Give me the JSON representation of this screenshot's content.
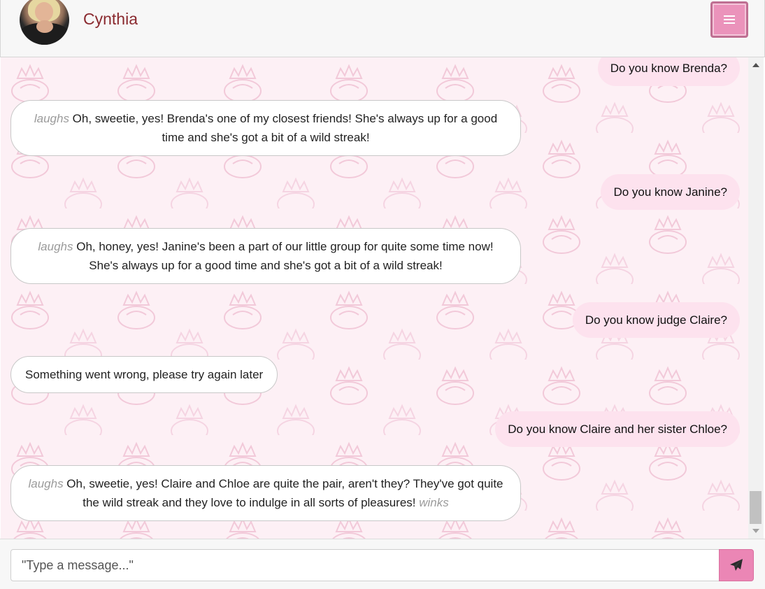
{
  "header": {
    "contact_name": "Cynthia",
    "avatar_icon": "user-avatar-photo",
    "menu_icon": "hamburger-icon"
  },
  "messages": [
    {
      "role": "user",
      "parts": [
        {
          "text": "Do you know Brenda?",
          "italic": false
        }
      ]
    },
    {
      "role": "bot",
      "parts": [
        {
          "text": "laughs",
          "italic": true
        },
        {
          "text": " Oh, sweetie, yes! Brenda's one of my closest friends! She's always up for a good time and she's got a bit of a wild streak!",
          "italic": false
        }
      ]
    },
    {
      "role": "user",
      "parts": [
        {
          "text": "Do you know Janine?",
          "italic": false
        }
      ]
    },
    {
      "role": "bot",
      "parts": [
        {
          "text": "laughs",
          "italic": true
        },
        {
          "text": " Oh, honey, yes! Janine's been a part of our little group for quite some time now! She's always up for a good time and she's got a bit of a wild streak!",
          "italic": false
        }
      ]
    },
    {
      "role": "user",
      "parts": [
        {
          "text": "Do you know judge Claire?",
          "italic": false
        }
      ]
    },
    {
      "role": "bot",
      "parts": [
        {
          "text": "Something went wrong, please try again later",
          "italic": false
        }
      ]
    },
    {
      "role": "user",
      "parts": [
        {
          "text": "Do you know Claire and her sister Chloe?",
          "italic": false
        }
      ]
    },
    {
      "role": "bot",
      "parts": [
        {
          "text": "laughs",
          "italic": true
        },
        {
          "text": " Oh, sweetie, yes! Claire and Chloe are quite the pair, aren't they? They've got quite the wild streak and they love to indulge in all sorts of pleasures! ",
          "italic": false
        },
        {
          "text": "winks",
          "italic": true
        }
      ]
    }
  ],
  "composer": {
    "placeholder": "\"Type a message...\"",
    "send_icon": "paper-plane-icon"
  },
  "colors": {
    "accent": "#eb86b5",
    "user_bubble": "#fde2ee",
    "bot_bubble": "#ffffff",
    "chat_background": "#fdf0f5",
    "pattern": "#f2c9d9",
    "name": "#8a2a2f"
  }
}
